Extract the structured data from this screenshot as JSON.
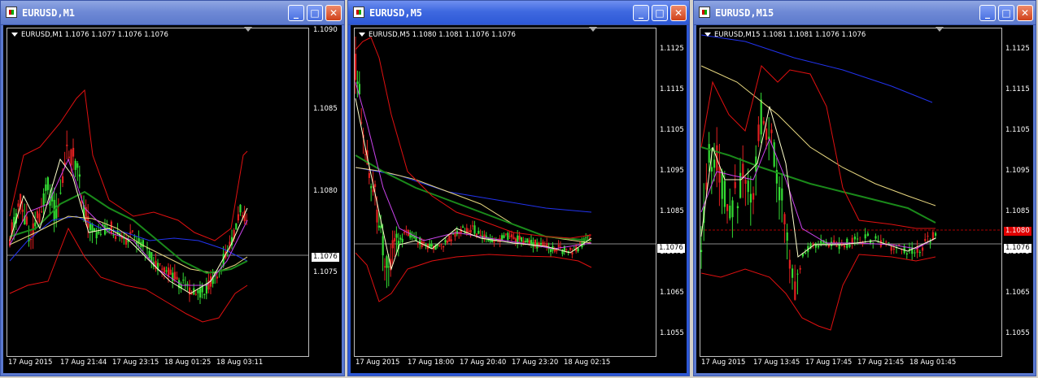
{
  "windows": [
    {
      "title": "EURUSD,M1",
      "header": "EURUSD,M1  1.1076 1.1077 1.1076 1.1076",
      "price_scale": [
        "1.1090",
        "1.1085",
        "1.1080",
        "1.1075"
      ],
      "time_scale": [
        "17 Aug 2015",
        "17 Aug 21:44",
        "17 Aug 23:15",
        "18 Aug 01:25",
        "18 Aug 03:11"
      ],
      "price_labels": [
        {
          "text": "1.1076",
          "bg": "#ffffff",
          "fg": "#000000"
        }
      ]
    },
    {
      "title": "EURUSD,M5",
      "header": "EURUSD,M5  1.1080 1.1081 1.1076 1.1076",
      "price_scale": [
        "1.1125",
        "1.1115",
        "1.1105",
        "1.1095",
        "1.1085",
        "1.1075",
        "1.1065",
        "1.1055"
      ],
      "time_scale": [
        "17 Aug 2015",
        "17 Aug 18:00",
        "17 Aug 20:40",
        "17 Aug 23:20",
        "18 Aug 02:15"
      ],
      "price_labels": [
        {
          "text": "1.1076",
          "bg": "#ffffff",
          "fg": "#000000"
        }
      ]
    },
    {
      "title": "EURUSD,M15",
      "header": "EURUSD,M15  1.1081 1.1081 1.1076 1.1076",
      "price_scale": [
        "1.1125",
        "1.1115",
        "1.1105",
        "1.1095",
        "1.1085",
        "1.1075",
        "1.1065",
        "1.1055"
      ],
      "time_scale": [
        "17 Aug 2015",
        "17 Aug 13:45",
        "17 Aug 17:45",
        "17 Aug 21:45",
        "18 Aug 01:45"
      ],
      "price_labels": [
        {
          "text": "1.1080",
          "bg": "#e00000",
          "fg": "#ffffff"
        },
        {
          "text": "1.1076",
          "bg": "#ffffff",
          "fg": "#000000"
        }
      ]
    }
  ],
  "buttons": {
    "minimize": "_",
    "maximize": "□",
    "close": "✕"
  },
  "colors": {
    "bull": "#33dd33",
    "bear": "#e02020",
    "bands": "#e01010",
    "ma_slow": "#2233ee",
    "ma_mid": "#e8d880",
    "ma_green": "#1a8a1a",
    "ma_fast": "#cc44ee",
    "ma_fastest": "#ffffcc"
  }
}
